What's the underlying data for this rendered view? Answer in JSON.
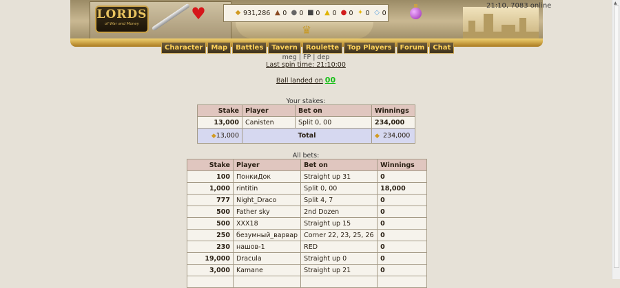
{
  "header": {
    "logo_title": "LORDS",
    "logo_subtitle": "of War and Money",
    "resources": [
      {
        "icon": "gold-coins-icon",
        "value": "931,286"
      },
      {
        "icon": "wood-icon",
        "value": "0"
      },
      {
        "icon": "stone-icon",
        "value": "0"
      },
      {
        "icon": "iron-icon",
        "value": "0"
      },
      {
        "icon": "sulfur-icon",
        "value": "0"
      },
      {
        "icon": "mercury-icon",
        "value": "0"
      },
      {
        "icon": "crystal-icon",
        "value": "0"
      },
      {
        "icon": "gem-icon",
        "value": "0"
      }
    ],
    "nav": [
      "Character",
      "Map",
      "Battles",
      "Tavern",
      "Roulette",
      "Top Players",
      "Forum",
      "Chat"
    ],
    "status": "21:10, 7083 online"
  },
  "roulette": {
    "links": "meg | FP | dep",
    "last_spin": "Last spin time: 21:10:00",
    "ball_label": "Ball landed on",
    "ball_number": "00"
  },
  "your_stakes": {
    "caption": "Your stakes:",
    "headers": [
      "Stake",
      "Player",
      "Bet on",
      "Winnings"
    ],
    "rows": [
      {
        "stake": "13,000",
        "player": "Canisten",
        "bet": "Split 0, 00",
        "win": "234,000"
      }
    ],
    "total": {
      "stake": "13,000",
      "label": "Total",
      "win": "234,000"
    }
  },
  "all_bets": {
    "caption": "All bets:",
    "headers": [
      "Stake",
      "Player",
      "Bet on",
      "Winnings"
    ],
    "rows": [
      {
        "stake": "100",
        "player": "ПонкиДок",
        "bet": "Straight up 31",
        "win": "0"
      },
      {
        "stake": "1,000",
        "player": "rintitin",
        "bet": "Split 0, 00",
        "win": "18,000"
      },
      {
        "stake": "777",
        "player": "Night_Draco",
        "bet": "Split 4, 7",
        "win": "0"
      },
      {
        "stake": "500",
        "player": "Father sky",
        "bet": "2nd Dozen",
        "win": "0"
      },
      {
        "stake": "500",
        "player": "XXX18",
        "bet": "Straight up 15",
        "win": "0"
      },
      {
        "stake": "250",
        "player": "безумный_варвар",
        "bet": "Corner 22, 23, 25, 26",
        "win": "0"
      },
      {
        "stake": "230",
        "player": "нашов-1",
        "bet": "RED",
        "win": "0"
      },
      {
        "stake": "19,000",
        "player": "Dracula",
        "bet": "Straight up 0",
        "win": "0"
      },
      {
        "stake": "3,000",
        "player": "Kamane",
        "bet": "Straight up 21",
        "win": "0"
      },
      {
        "stake": "",
        "player": "",
        "bet": "",
        "win": ""
      }
    ]
  }
}
